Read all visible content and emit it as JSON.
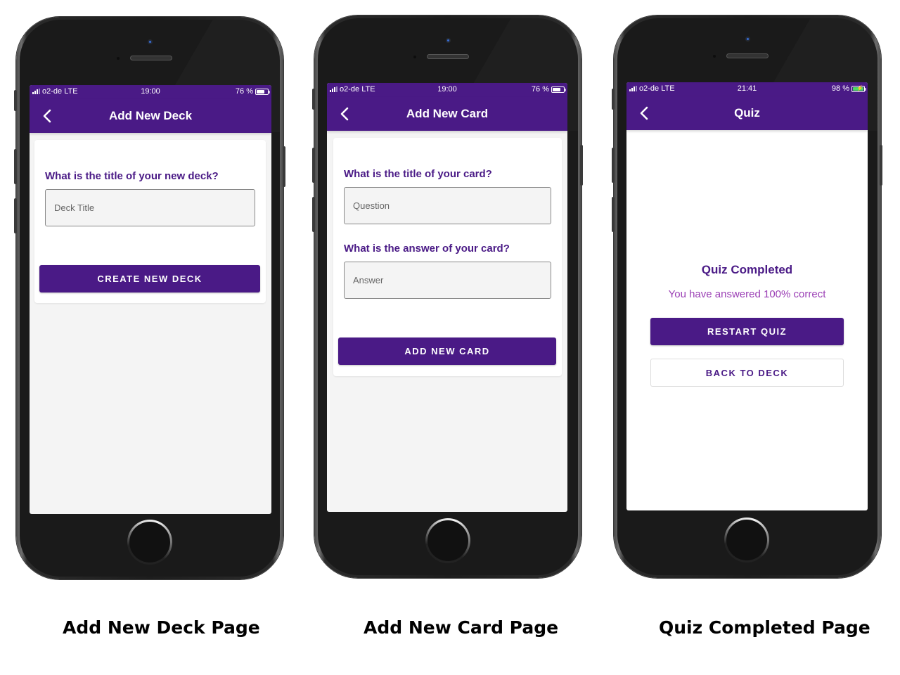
{
  "colors": {
    "brand": "#4a1a86",
    "subtitle": "#9b3fb5",
    "screen_bg": "#f4f4f4"
  },
  "phones": [
    {
      "status": {
        "carrier": "o2-de LTE",
        "time": "19:00",
        "battery": "76 %",
        "battery_level": 0.76,
        "charging": false
      },
      "nav": {
        "back_icon": "chevron-left-icon",
        "title": "Add New Deck"
      },
      "form": {
        "question_label": "What is the title of your new deck?",
        "input_placeholder": "Deck Title",
        "input_value": "",
        "submit_label": "CREATE NEW DECK"
      },
      "caption": "Add New Deck Page"
    },
    {
      "status": {
        "carrier": "o2-de LTE",
        "time": "19:00",
        "battery": "76 %",
        "battery_level": 0.76,
        "charging": false
      },
      "nav": {
        "back_icon": "chevron-left-icon",
        "title": "Add New Card"
      },
      "form": {
        "question_label": "What is the title of your card?",
        "question_placeholder": "Question",
        "question_value": "",
        "answer_label": "What is the answer of your card?",
        "answer_placeholder": "Answer",
        "answer_value": "",
        "submit_label": "ADD NEW CARD"
      },
      "caption": "Add New Card Page"
    },
    {
      "status": {
        "carrier": "o2-de LTE",
        "time": "21:41",
        "battery": "98 %",
        "battery_level": 0.98,
        "charging": true
      },
      "nav": {
        "back_icon": "chevron-left-icon",
        "title": "Quiz"
      },
      "result": {
        "heading": "Quiz Completed",
        "message": "You have answered 100% correct",
        "restart_label": "RESTART QUIZ",
        "back_label": "BACK TO DECK"
      },
      "caption": "Quiz Completed Page"
    }
  ]
}
